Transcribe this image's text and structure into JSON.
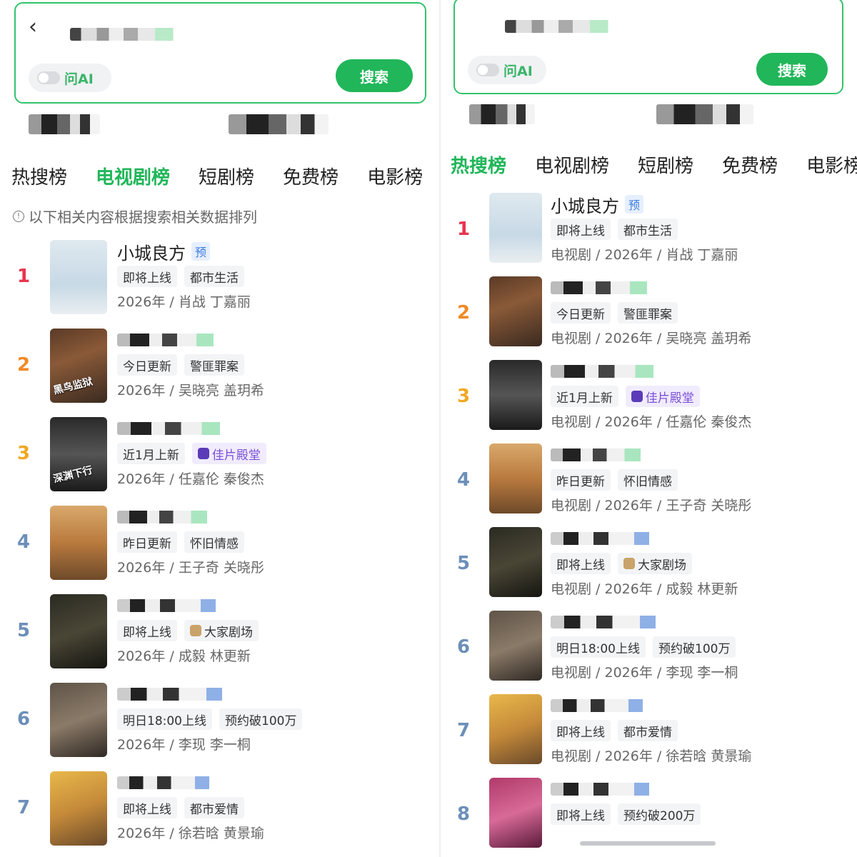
{
  "left": {
    "ai_label": "问AI",
    "search_button": "搜索",
    "tabs": [
      {
        "label": "热搜榜",
        "active": false
      },
      {
        "label": "电视剧榜",
        "active": true
      },
      {
        "label": "短剧榜",
        "active": false
      },
      {
        "label": "免费榜",
        "active": false
      },
      {
        "label": "电影榜",
        "active": false
      }
    ],
    "notice": "以下相关内容根据搜索相关数据排列",
    "items": [
      {
        "rank": "1",
        "title": "小城良方",
        "badge": "预",
        "tags": [
          "即将上线",
          "都市生活"
        ],
        "meta": "2026年 / 肖战 丁嘉丽"
      },
      {
        "rank": "2",
        "title": "",
        "tags": [
          "今日更新",
          "警匪罪案"
        ],
        "meta": "2026年 / 吴晓亮 盖玥希",
        "poster_text": "黑鸟监狱"
      },
      {
        "rank": "3",
        "title": "",
        "tags": [
          "近1月上新",
          "佳片殿堂"
        ],
        "meta": "2026年 / 任嘉伦 秦俊杰",
        "poster_text": "深渊下行"
      },
      {
        "rank": "4",
        "title": "",
        "tags": [
          "昨日更新",
          "怀旧情感"
        ],
        "meta": "2026年 / 王子奇 关晓彤"
      },
      {
        "rank": "5",
        "title": "",
        "tags": [
          "即将上线",
          "大家剧场"
        ],
        "meta": "2026年 / 成毅 林更新"
      },
      {
        "rank": "6",
        "title": "",
        "tags": [
          "明日18:00上线",
          "预约破100万"
        ],
        "meta": "2026年 / 李现 李一桐"
      },
      {
        "rank": "7",
        "title": "",
        "tags": [
          "即将上线",
          "都市爱情"
        ],
        "meta": "2026年 / 徐若晗 黄景瑜"
      }
    ]
  },
  "right": {
    "ai_label": "问AI",
    "search_button": "搜索",
    "tabs": [
      {
        "label": "热搜榜",
        "active": true
      },
      {
        "label": "电视剧榜",
        "active": false
      },
      {
        "label": "短剧榜",
        "active": false
      },
      {
        "label": "免费榜",
        "active": false
      },
      {
        "label": "电影榜",
        "active": false
      }
    ],
    "items": [
      {
        "rank": "1",
        "title": "小城良方",
        "badge": "预",
        "tags": [
          "即将上线",
          "都市生活"
        ],
        "meta": "电视剧 / 2026年 / 肖战 丁嘉丽"
      },
      {
        "rank": "2",
        "title": "",
        "tags": [
          "今日更新",
          "警匪罪案"
        ],
        "meta": "电视剧 / 2026年 / 吴晓亮 盖玥希"
      },
      {
        "rank": "3",
        "title": "",
        "tags": [
          "近1月上新",
          "佳片殿堂"
        ],
        "meta": "电视剧 / 2026年 / 任嘉伦 秦俊杰"
      },
      {
        "rank": "4",
        "title": "",
        "tags": [
          "昨日更新",
          "怀旧情感"
        ],
        "meta": "电视剧 / 2026年 / 王子奇 关晓彤"
      },
      {
        "rank": "5",
        "title": "",
        "tags": [
          "即将上线",
          "大家剧场"
        ],
        "meta": "电视剧 / 2026年 / 成毅 林更新"
      },
      {
        "rank": "6",
        "title": "",
        "tags": [
          "明日18:00上线",
          "预约破100万"
        ],
        "meta": "电视剧 / 2026年 / 李现 李一桐"
      },
      {
        "rank": "7",
        "title": "",
        "tags": [
          "即将上线",
          "都市爱情"
        ],
        "meta": "电视剧 / 2026年 / 徐若晗 黄景瑜"
      },
      {
        "rank": "8",
        "title": "",
        "tags": [
          "即将上线",
          "预约破200万"
        ],
        "meta": ""
      }
    ]
  },
  "colors": {
    "accent_green": "#21b65a",
    "rank_1": "#e8344e",
    "rank_2": "#f08a24",
    "rank_3": "#f0a824",
    "rank_other": "#6c8fb8"
  },
  "icons": {
    "back": "chevron-left-icon",
    "info": "info-circle-icon",
    "toggle": "toggle-switch-icon"
  }
}
